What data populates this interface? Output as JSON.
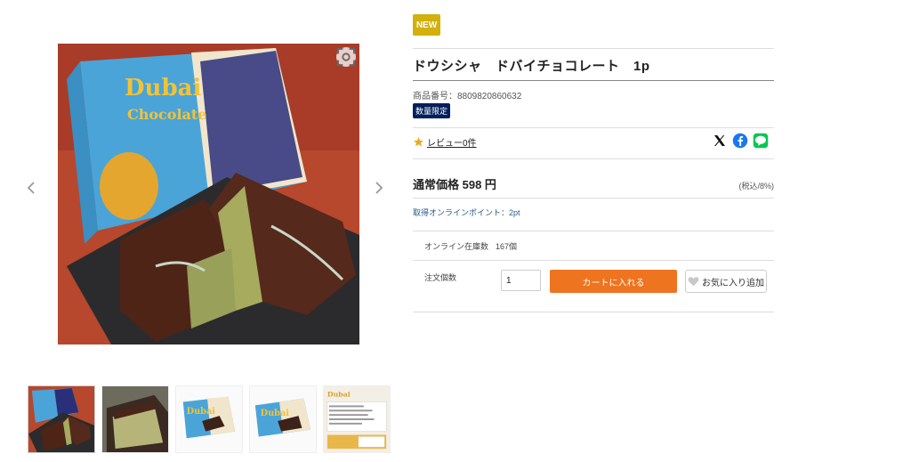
{
  "gallery": {
    "main_image_alt": "Dubai Chocolate",
    "box_brand_line1": "Dubai",
    "box_brand_line2": "Chocolate",
    "thumbnails": [
      {
        "id": "thumb-1",
        "active": true
      },
      {
        "id": "thumb-2",
        "active": false
      },
      {
        "id": "thumb-3",
        "active": false
      },
      {
        "id": "thumb-4",
        "active": false
      },
      {
        "id": "thumb-5",
        "active": false
      }
    ]
  },
  "product": {
    "new_badge": "NEW",
    "title": "ドウシシャ　ドバイチョコレート　1p",
    "sku": "商品番号：8809820860632",
    "limited_badge": "数量限定",
    "review_link": "レビュー0件",
    "price_label": "通常価格 598 円",
    "tax_note": "(税込/8%)",
    "points": "取得オンラインポイント：2pt",
    "stock_label": "オンライン在庫数",
    "stock_value": "167個",
    "qty_label": "注文個数",
    "qty_value": "1",
    "cart_button": "カートに入れる",
    "favorite_button": "お気に入り追加"
  },
  "colors": {
    "new_badge": "#d3b00c",
    "limited_badge": "#001f5b",
    "cart_button": "#ee7420",
    "star": "#f0a81c",
    "facebook": "#1877f2",
    "line": "#06c755"
  },
  "icons": {
    "zoom": "zoom-icon",
    "prev": "chevron-left-icon",
    "next": "chevron-right-icon",
    "star": "star-icon",
    "x": "x-logo-icon",
    "facebook": "facebook-icon",
    "line": "line-icon",
    "heart": "heart-icon"
  }
}
